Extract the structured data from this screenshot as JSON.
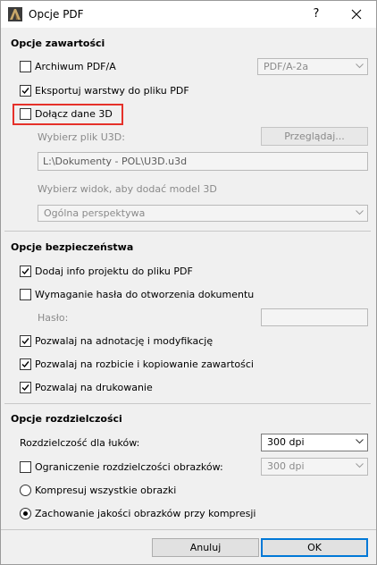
{
  "window": {
    "title": "Opcje PDF",
    "help_glyph": "?",
    "close_icon": "close-icon",
    "app_icon": "archicad-app-icon"
  },
  "content_options": {
    "section_title": "Opcje zawartości",
    "archive_pdfa": {
      "label": "Archiwum PDF/A",
      "checked": false
    },
    "pdfa_select": {
      "value": "PDF/A-2a",
      "enabled": false
    },
    "export_layers": {
      "label": "Eksportuj warstwy do pliku PDF",
      "checked": true
    },
    "include_3d": {
      "label": "Dołącz dane 3D",
      "checked": false,
      "highlight_color": "#e5312a"
    },
    "u3d_file_label": "Wybierz plik U3D:",
    "browse_button": "Przeglądaj...",
    "u3d_path": "L:\\Dokumenty - POL\\U3D.u3d",
    "view_label": "Wybierz widok, aby dodać model 3D",
    "view_select": {
      "value": "Ogólna perspektywa",
      "enabled": false
    }
  },
  "security_options": {
    "section_title": "Opcje bezpieczeństwa",
    "add_project_info": {
      "label": "Dodaj info projektu do pliku PDF",
      "checked": true
    },
    "require_password": {
      "label": "Wymaganie hasła do otworzenia dokumentu",
      "checked": false
    },
    "password_label": "Hasło:",
    "password_value": "",
    "allow_annotation": {
      "label": "Pozwalaj na adnotację i modyfikację",
      "checked": true
    },
    "allow_copy": {
      "label": "Pozwalaj na rozbicie i kopiowanie zawartości",
      "checked": true
    },
    "allow_print": {
      "label": "Pozwalaj na drukowanie",
      "checked": true
    }
  },
  "resolution_options": {
    "section_title": "Opcje rozdzielczości",
    "arc_resolution_label": "Rozdzielczość dla łuków:",
    "arc_resolution_select": {
      "value": "300 dpi",
      "enabled": true
    },
    "limit_image_resolution": {
      "label": "Ograniczenie rozdzielczości obrazków:",
      "checked": false
    },
    "image_resolution_select": {
      "value": "300 dpi",
      "enabled": false
    },
    "compress_all": {
      "label": "Kompresuj wszystkie obrazki",
      "selected": false
    },
    "keep_quality": {
      "label": "Zachowanie jakości obrazków przy kompresji",
      "selected": true
    }
  },
  "footer": {
    "cancel_label": "Anuluj",
    "ok_label": "OK"
  }
}
